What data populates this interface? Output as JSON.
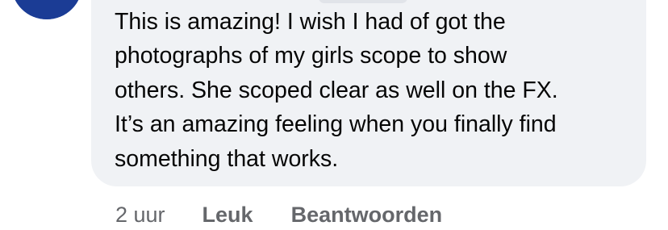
{
  "comment": {
    "author_partial": "",
    "text_lines": [
      "This is amazing! I wish I had of got the",
      "photographs of my girls scope to show",
      "others. She scoped clear as well on the FX.",
      "It’s an amazing feeling when you finally find",
      "something that works."
    ]
  },
  "actions": {
    "timestamp": "2 uur",
    "like_label": "Leuk",
    "reply_label": "Beantwoorden"
  },
  "colors": {
    "bubble": "#f0f2f5",
    "text": "#050505",
    "secondary_text": "#65676b",
    "avatar_blue": "#2f56b5"
  }
}
